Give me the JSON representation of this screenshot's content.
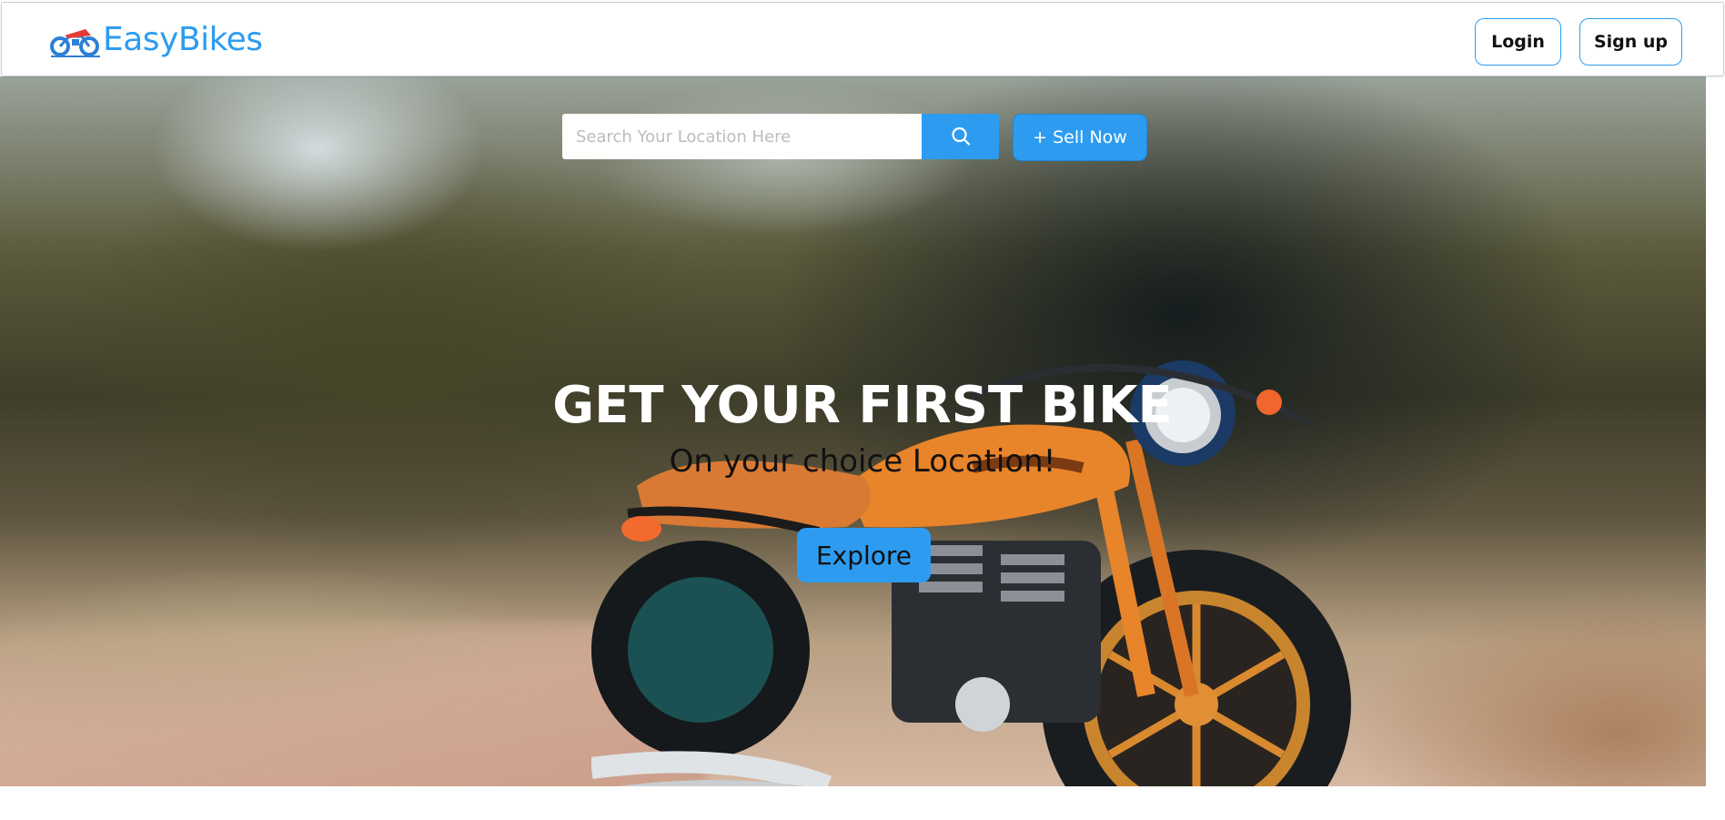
{
  "header": {
    "brand_name": "EasyBikes",
    "logo_icon": "motorbike-logo-icon",
    "login_label": "Login",
    "signup_label": "Sign up"
  },
  "search": {
    "placeholder": "Search Your Location Here",
    "value": "",
    "icon": "search-icon"
  },
  "sell_button_label": "+ Sell Now",
  "hero": {
    "title": "GET YOUR FIRST BIKE",
    "subtitle": "On your choice Location!",
    "cta_label": "Explore"
  },
  "colors": {
    "accent": "#2d9cf0",
    "logo_red": "#e53935",
    "bike_orange": "#e8842a"
  }
}
